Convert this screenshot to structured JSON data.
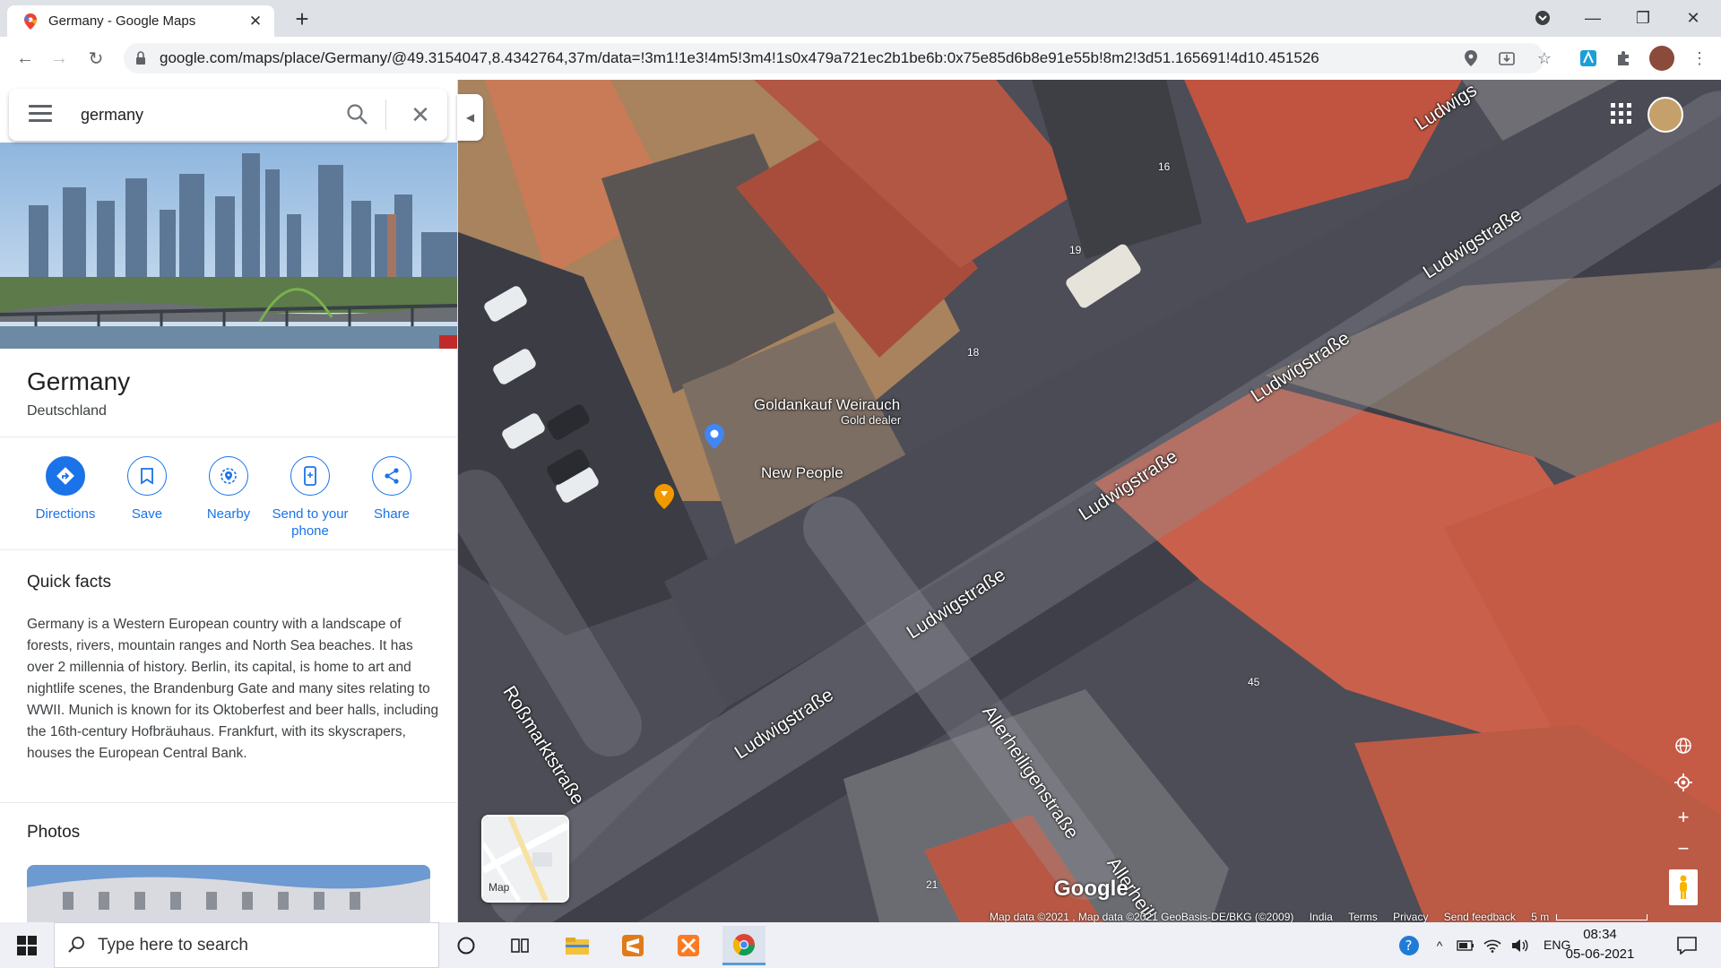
{
  "browser": {
    "tab_title": "Germany - Google Maps",
    "url": "google.com/maps/place/Germany/@49.3154047,8.4342764,37m/data=!3m1!1e3!4m5!3m4!1s0x479a721ec2b1be6b:0x75e85d6b8e91e55b!8m2!3d51.165691!4d10.451526"
  },
  "search": {
    "query": "germany"
  },
  "place": {
    "title": "Germany",
    "subtitle": "Deutschland",
    "actions": [
      {
        "label": "Directions",
        "icon": "directions-icon"
      },
      {
        "label": "Save",
        "icon": "bookmark-icon"
      },
      {
        "label": "Nearby",
        "icon": "nearby-icon"
      },
      {
        "label": "Send to your phone",
        "icon": "phone-icon"
      },
      {
        "label": "Share",
        "icon": "share-icon"
      }
    ],
    "quick_facts_title": "Quick facts",
    "quick_facts": "Germany is a Western European country with a landscape of forests, rivers, mountain ranges and North Sea beaches. It has over 2 millennia of history. Berlin, its capital, is home to art and nightlife scenes, the Brandenburg Gate and many sites relating to WWII. Munich is known for its Oktoberfest and beer halls, including the 16th-century Hofbräuhaus. Frankfurt, with its skyscrapers, houses the European Central Bank.",
    "photos_title": "Photos"
  },
  "map": {
    "streets": [
      "Ludwigstraße",
      "Ludwigstraße",
      "Ludwigstraße",
      "Ludwigstraße",
      "Ludwigstraße",
      "Ludwigstraße",
      "Roßmarktstraße",
      "Allerheiligenstraße",
      "Allerheili",
      "Ludwigs"
    ],
    "pois": [
      {
        "name": "Goldankauf Weirauch",
        "category": "Gold dealer"
      },
      {
        "name": "New People"
      }
    ],
    "house_numbers": [
      "16",
      "19",
      "18",
      "45",
      "21"
    ],
    "layer_toggle_label": "Map",
    "logo": "Google",
    "attribution": [
      "Map data ©2021 , Map data ©2021 GeoBasis-DE/BKG (©2009)",
      "India",
      "Terms",
      "Privacy",
      "Send feedback",
      "5 m"
    ]
  },
  "taskbar": {
    "search_placeholder": "Type here to search",
    "language": "ENG",
    "time": "08:34",
    "date": "05-06-2021"
  },
  "colors": {
    "accent": "#1a73e8",
    "roof": "#b5553e",
    "road": "#3e3f48"
  }
}
